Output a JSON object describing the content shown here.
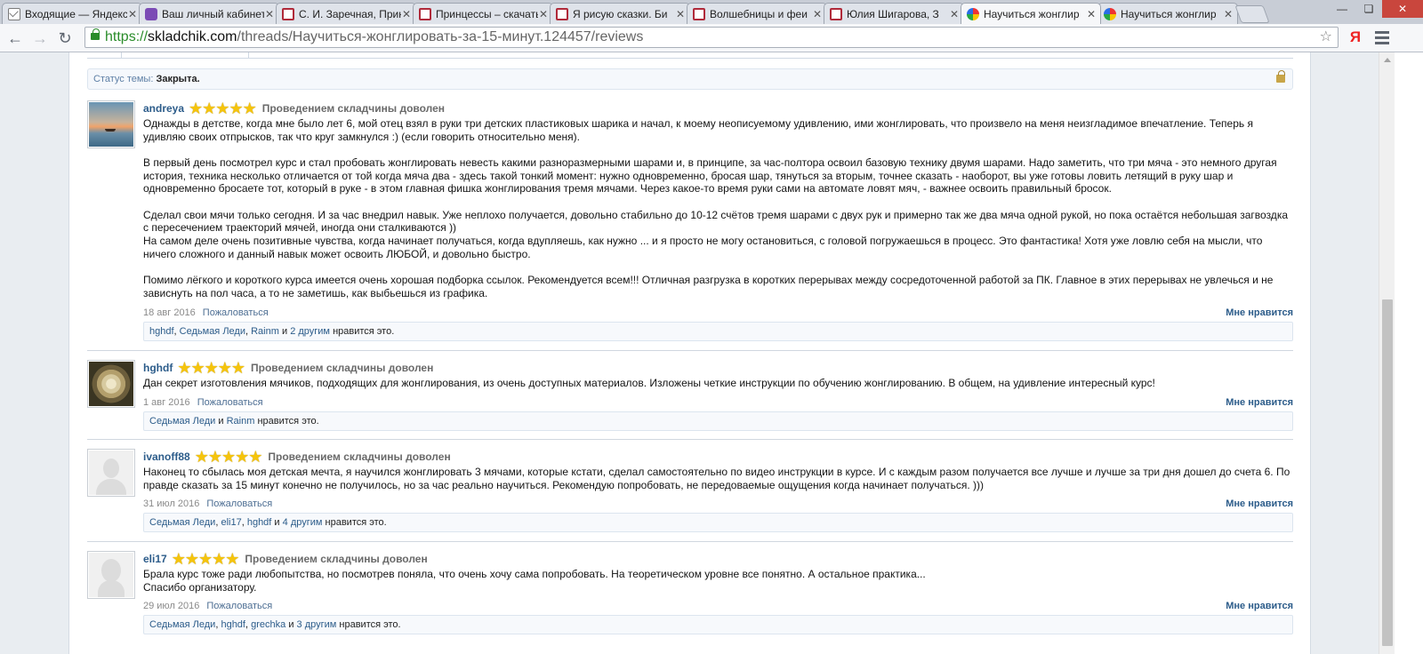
{
  "browser": {
    "tabs": [
      {
        "title": "Входящие — Яндекс.Почта",
        "favicon": "mail-icon",
        "active": false
      },
      {
        "title": "Ваш личный кабинет",
        "favicon": "cube-icon",
        "active": false
      },
      {
        "title": "С. И. Заречная, Прин",
        "favicon": "book-icon",
        "active": false
      },
      {
        "title": "Принцессы – скачать",
        "favicon": "book-icon",
        "active": false
      },
      {
        "title": "Я рисую сказки. Би",
        "favicon": "book-icon",
        "active": false
      },
      {
        "title": "Волшебницы и феи",
        "favicon": "book-icon",
        "active": false
      },
      {
        "title": "Юлия Шигарова, З",
        "favicon": "book-icon",
        "active": false
      },
      {
        "title": "Научиться жонглир",
        "favicon": "ball-icon",
        "active": true
      },
      {
        "title": "Научиться жонглир",
        "favicon": "ball-icon",
        "active": false
      }
    ],
    "url": {
      "scheme": "https://",
      "host": "skladchik.com",
      "path": "/threads/Научиться-жонглировать-за-15-минут.124457/reviews"
    }
  },
  "page": {
    "status_label": "Статус темы:",
    "status_value": "Закрыта.",
    "reviews": [
      {
        "user": "andreya",
        "stars": "★★★★★",
        "rating_text": "Проведением складчины доволен",
        "avatar": "sunset",
        "paragraphs": [
          "Однажды в детстве, когда мне было лет 6, мой отец взял в руки три детских пластиковых шарика и начал, к моему неописуемому удивлению, ими жонглировать, что произвело на меня неизгладимое впечатление. Теперь я удивляю своих отпрысков, так что круг замкнулся :) (если говорить относительно меня).",
          "В первый день посмотрел курс и стал пробовать жонглировать невесть какими разноразмерными шарами и, в принципе, за час-полтора освоил базовую технику двумя шарами. Надо заметить, что три мяча - это немного другая история, техника несколько отличается от той когда мяча два - здесь такой тонкий момент: нужно одновременно, бросая шар, тянуться за вторым, точнее сказать - наоборот, вы уже готовы ловить летящий в руку шар и одновременно бросаете тот, который в руке - в этом главная фишка жонглирования тремя мячами. Через какое-то время руки сами на автомате ловят мяч, - важнее освоить правильный бросок.",
          "Сделал свои мячи только сегодня. И за час внедрил навык. Уже неплохо получается, довольно стабильно до 10-12 счётов тремя шарами с двух рук и примерно так же два мяча одной рукой, но пока остаётся небольшая загвоздка с пересечением траекторий мячей, иногда они сталкиваются ))\nНа самом деле очень позитивные чувства, когда начинает получаться, когда вдупляешь, как нужно ... и я просто не могу остановиться, с головой погружаешься в процесс. Это фантастика! Хотя уже ловлю себя на мысли, что ничего сложного и данный навык может освоить ЛЮБОЙ, и довольно быстро.",
          "Помимо лёгкого и короткого курса имеется очень хорошая подборка ссылок. Рекомендуется всем!!! Отличная разгрузка в коротких перерывах между сосредоточенной работой за ПК. Главное в этих перерывах не увлечься и не зависнуть на пол часа, а то не заметишь, как выбьешься из графика."
        ],
        "date": "18 авг 2016",
        "report": "Пожаловаться",
        "like": "Мне нравится",
        "likers": [
          "hghdf",
          "Седьмая Леди",
          "Rainm"
        ],
        "likers_join": "и",
        "likers_more": "2 другим",
        "likes_suffix": "нравится это."
      },
      {
        "user": "hghdf",
        "stars": "★★★★★",
        "rating_text": "Проведением складчины доволен",
        "avatar": "rose",
        "paragraphs": [
          "Дан секрет изготовления мячиков, подходящих для жонглирования, из очень доступных материалов. Изложены четкие инструкции по обучению жонглированию. В общем, на удивление интересный курс!"
        ],
        "date": "1 авг 2016",
        "report": "Пожаловаться",
        "like": "Мне нравится",
        "likers": [
          "Седьмая Леди"
        ],
        "likers_join": "и",
        "likers_more": "Rainm",
        "likes_suffix": "нравится это."
      },
      {
        "user": "ivanoff88",
        "stars": "★★★★★",
        "rating_text": "Проведением складчины доволен",
        "avatar": "male",
        "paragraphs": [
          "Наконец то сбылась моя детская мечта, я научился жонглировать 3 мячами, которые кстати, сделал самостоятельно по видео инструкции в курсе. И с каждым разом получается все лучше и лучше за три дня дошел до счета 6. По правде сказать за 15 минут конечно не получилось, но за час реально научиться. Рекомендую попробовать, не передоваемые ощущения когда начинает получаться. )))"
        ],
        "date": "31 июл 2016",
        "report": "Пожаловаться",
        "like": "Мне нравится",
        "likers": [
          "Седьмая Леди",
          "eli17",
          "hghdf"
        ],
        "likers_join": "и",
        "likers_more": "4 другим",
        "likes_suffix": "нравится это."
      },
      {
        "user": "eli17",
        "stars": "★★★★★",
        "rating_text": "Проведением складчины доволен",
        "avatar": "female",
        "paragraphs": [
          "Брала курс тоже ради любопытства, но посмотрев поняла, что очень хочу сама попробовать. На теоретическом уровне все понятно. А остальное практика...\nСпасибо организатору."
        ],
        "date": "29 июл 2016",
        "report": "Пожаловаться",
        "like": "Мне нравится",
        "likers": [
          "Седьмая Леди",
          "hghdf",
          "grechka"
        ],
        "likers_join": "и",
        "likers_more": "3 другим",
        "likes_suffix": "нравится это."
      }
    ]
  }
}
